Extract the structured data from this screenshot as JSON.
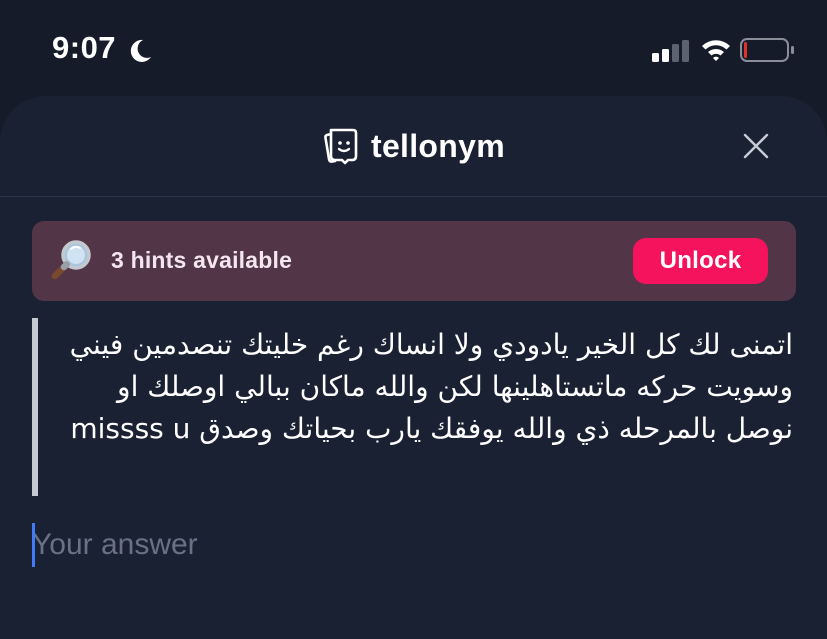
{
  "status_bar": {
    "time": "9:07",
    "icons": [
      "moon-icon",
      "cellular-signal-icon",
      "wifi-icon",
      "battery-low-icon"
    ],
    "battery_color": "#e0322d"
  },
  "header": {
    "brand_name": "tellonym",
    "logo_icon": "tellonym-logo-icon",
    "close_icon": "close-icon"
  },
  "hints": {
    "icon": "magnifier-icon",
    "text": "3 hints available",
    "unlock_label": "Unlock"
  },
  "question": {
    "text": "اتمنى لك كل الخير يادودي ولا انساك رغم خليتك تنصدمين فيني وسويت حركه ماتستاهلينها لكن والله ماكان ببالي اوصلك او نوصل بالمرحله ذي والله يوفقك يارب بحياتك وصدق missss u"
  },
  "answer": {
    "placeholder": "Your answer",
    "value": ""
  },
  "colors": {
    "background": "#151b28",
    "sheet": "#1a2132",
    "banner": "#533548",
    "accent": "#f4135c",
    "caret": "#3f7cf5"
  }
}
